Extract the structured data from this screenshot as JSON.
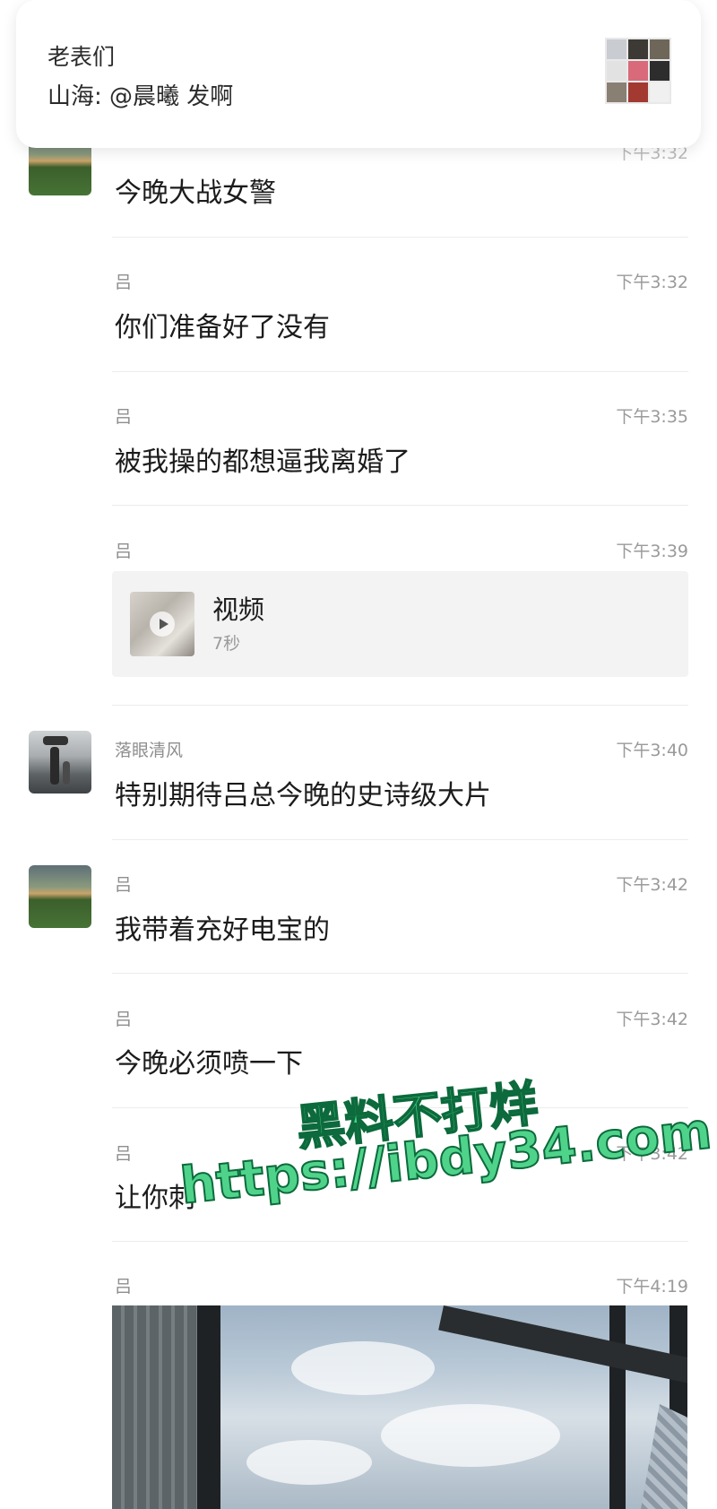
{
  "notification": {
    "group_name": "老表们",
    "preview": "山海: @晨曦 发啊"
  },
  "messages": [
    {
      "sender": "",
      "time": "下午3:32",
      "text": "今晚大战女警"
    },
    {
      "sender": "吕",
      "time": "下午3:32",
      "text": "你们准备好了没有"
    },
    {
      "sender": "吕",
      "time": "下午3:35",
      "text": "被我操的都想逼我离婚了"
    },
    {
      "sender": "吕",
      "time": "下午3:39",
      "video": {
        "title": "视频",
        "duration": "7秒"
      }
    },
    {
      "sender": "落眼清风",
      "time": "下午3:40",
      "text": "特别期待吕总今晚的史诗级大片"
    },
    {
      "sender": "吕",
      "time": "下午3:42",
      "text": "我带着充好电宝的"
    },
    {
      "sender": "吕",
      "time": "下午3:42",
      "text": "今晚必须喷一下"
    },
    {
      "sender": "吕",
      "time": "下午3:42",
      "text": "让你刺"
    },
    {
      "sender": "吕",
      "time": "下午4:19",
      "image": "photo"
    }
  ],
  "watermark": {
    "line1": "黑料不打烊",
    "line2": "https://ibdy34.com"
  }
}
